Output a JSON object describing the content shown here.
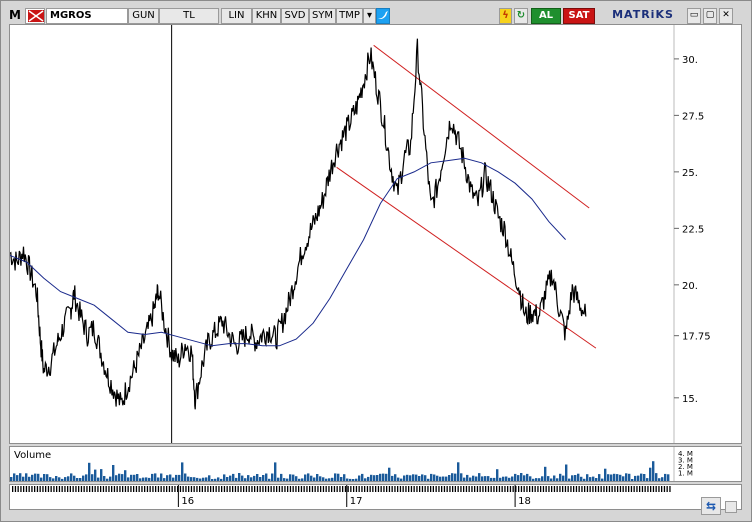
{
  "toolbar": {
    "logo": "M",
    "symbol": "MGROS",
    "period": "GUN",
    "currency": "TL",
    "scale": "LIN",
    "khn": "KHN",
    "svd": "SVD",
    "sym": "SYM",
    "tmp": "TMP",
    "dropdown": "▾",
    "bolt": "ϟ",
    "refresh": "↻",
    "buy": "AL",
    "sell": "SAT",
    "brand": "MATRiKS",
    "minimize": "▭",
    "maximize": "▢",
    "close": "✕",
    "sync": "⇆"
  },
  "colors": {
    "price_line": "#000000",
    "moving_average": "#1a2a8c",
    "channel": "#d02020",
    "volume": "#1a5a9a",
    "buy": "#1f8f2e",
    "sell": "#c91414"
  },
  "chart_data": {
    "type": "line",
    "symbol": "MGROS",
    "y_ticks": [
      "30.",
      "27.5",
      "25.",
      "22.5",
      "20.",
      "17.75",
      "15."
    ],
    "y_tick_values": [
      30,
      27.5,
      25,
      22.5,
      20,
      17.75,
      15
    ],
    "ylim": [
      13,
      31.5
    ],
    "x_ticks": [
      "16",
      "17",
      "18"
    ],
    "x_tick_positions": [
      0.5,
      1.0,
      1.5
    ],
    "xlim": [
      0,
      1.96
    ],
    "volume_label": "Volume",
    "volume_ticks": [
      "4. M",
      "3. M",
      "2. M",
      "1. M"
    ],
    "crosshair_x": 0.48,
    "price_series": [
      [
        0.0,
        21.4
      ],
      [
        0.02,
        21.0
      ],
      [
        0.04,
        21.5
      ],
      [
        0.06,
        20.6
      ],
      [
        0.08,
        19.6
      ],
      [
        0.09,
        17.6
      ],
      [
        0.1,
        16.2
      ],
      [
        0.12,
        16.5
      ],
      [
        0.14,
        17.4
      ],
      [
        0.16,
        18.2
      ],
      [
        0.18,
        18.9
      ],
      [
        0.19,
        19.6
      ],
      [
        0.21,
        18.6
      ],
      [
        0.23,
        17.8
      ],
      [
        0.25,
        18.1
      ],
      [
        0.27,
        17.0
      ],
      [
        0.29,
        16.0
      ],
      [
        0.31,
        15.3
      ],
      [
        0.33,
        14.7
      ],
      [
        0.35,
        15.6
      ],
      [
        0.37,
        16.3
      ],
      [
        0.39,
        17.2
      ],
      [
        0.41,
        18.0
      ],
      [
        0.43,
        19.0
      ],
      [
        0.44,
        19.8
      ],
      [
        0.46,
        18.2
      ],
      [
        0.48,
        17.0
      ],
      [
        0.5,
        16.6
      ],
      [
        0.52,
        17.4
      ],
      [
        0.54,
        17.0
      ],
      [
        0.55,
        14.9
      ],
      [
        0.57,
        16.4
      ],
      [
        0.59,
        17.5
      ],
      [
        0.61,
        17.9
      ],
      [
        0.63,
        18.4
      ],
      [
        0.65,
        17.8
      ],
      [
        0.67,
        17.3
      ],
      [
        0.69,
        17.6
      ],
      [
        0.71,
        17.9
      ],
      [
        0.73,
        17.5
      ],
      [
        0.75,
        17.8
      ],
      [
        0.77,
        18.0
      ],
      [
        0.79,
        17.6
      ],
      [
        0.81,
        18.4
      ],
      [
        0.83,
        19.3
      ],
      [
        0.85,
        20.5
      ],
      [
        0.87,
        21.6
      ],
      [
        0.89,
        22.3
      ],
      [
        0.91,
        23.0
      ],
      [
        0.93,
        23.8
      ],
      [
        0.95,
        25.0
      ],
      [
        0.97,
        26.0
      ],
      [
        0.99,
        26.6
      ],
      [
        1.01,
        27.2
      ],
      [
        1.03,
        27.9
      ],
      [
        1.05,
        29.0
      ],
      [
        1.07,
        30.2
      ],
      [
        1.09,
        28.7
      ],
      [
        1.11,
        27.2
      ],
      [
        1.13,
        25.3
      ],
      [
        1.15,
        24.0
      ],
      [
        1.17,
        25.6
      ],
      [
        1.19,
        26.2
      ],
      [
        1.21,
        30.4
      ],
      [
        1.23,
        26.8
      ],
      [
        1.25,
        23.4
      ],
      [
        1.27,
        24.4
      ],
      [
        1.29,
        26.0
      ],
      [
        1.31,
        27.4
      ],
      [
        1.33,
        26.4
      ],
      [
        1.35,
        25.4
      ],
      [
        1.37,
        24.1
      ],
      [
        1.39,
        23.6
      ],
      [
        1.41,
        24.9
      ],
      [
        1.43,
        24.1
      ],
      [
        1.45,
        23.0
      ],
      [
        1.47,
        22.4
      ],
      [
        1.49,
        21.0
      ],
      [
        1.51,
        20.0
      ],
      [
        1.53,
        18.6
      ],
      [
        1.55,
        18.8
      ],
      [
        1.57,
        18.6
      ],
      [
        1.59,
        19.6
      ],
      [
        1.61,
        20.5
      ],
      [
        1.63,
        19.0
      ],
      [
        1.65,
        17.8
      ],
      [
        1.67,
        19.8
      ],
      [
        1.69,
        19.2
      ],
      [
        1.71,
        18.6
      ]
    ],
    "moving_average": [
      [
        0.0,
        21.3
      ],
      [
        0.05,
        21.0
      ],
      [
        0.1,
        20.3
      ],
      [
        0.15,
        19.7
      ],
      [
        0.2,
        19.4
      ],
      [
        0.25,
        19.1
      ],
      [
        0.3,
        18.5
      ],
      [
        0.35,
        17.9
      ],
      [
        0.4,
        17.8
      ],
      [
        0.45,
        17.9
      ],
      [
        0.5,
        17.7
      ],
      [
        0.55,
        17.5
      ],
      [
        0.6,
        17.3
      ],
      [
        0.65,
        17.4
      ],
      [
        0.7,
        17.4
      ],
      [
        0.75,
        17.3
      ],
      [
        0.8,
        17.3
      ],
      [
        0.85,
        17.6
      ],
      [
        0.9,
        18.3
      ],
      [
        0.95,
        19.4
      ],
      [
        1.0,
        20.7
      ],
      [
        1.05,
        22.0
      ],
      [
        1.1,
        23.6
      ],
      [
        1.15,
        24.7
      ],
      [
        1.2,
        25.0
      ],
      [
        1.25,
        25.4
      ],
      [
        1.3,
        25.5
      ],
      [
        1.35,
        25.6
      ],
      [
        1.4,
        25.4
      ],
      [
        1.45,
        25.0
      ],
      [
        1.5,
        24.5
      ],
      [
        1.55,
        23.8
      ],
      [
        1.6,
        22.8
      ],
      [
        1.65,
        22.0
      ]
    ],
    "channel_upper": [
      [
        1.08,
        30.6
      ],
      [
        1.72,
        23.4
      ]
    ],
    "channel_lower": [
      [
        0.97,
        25.2
      ],
      [
        1.74,
        17.2
      ]
    ]
  }
}
